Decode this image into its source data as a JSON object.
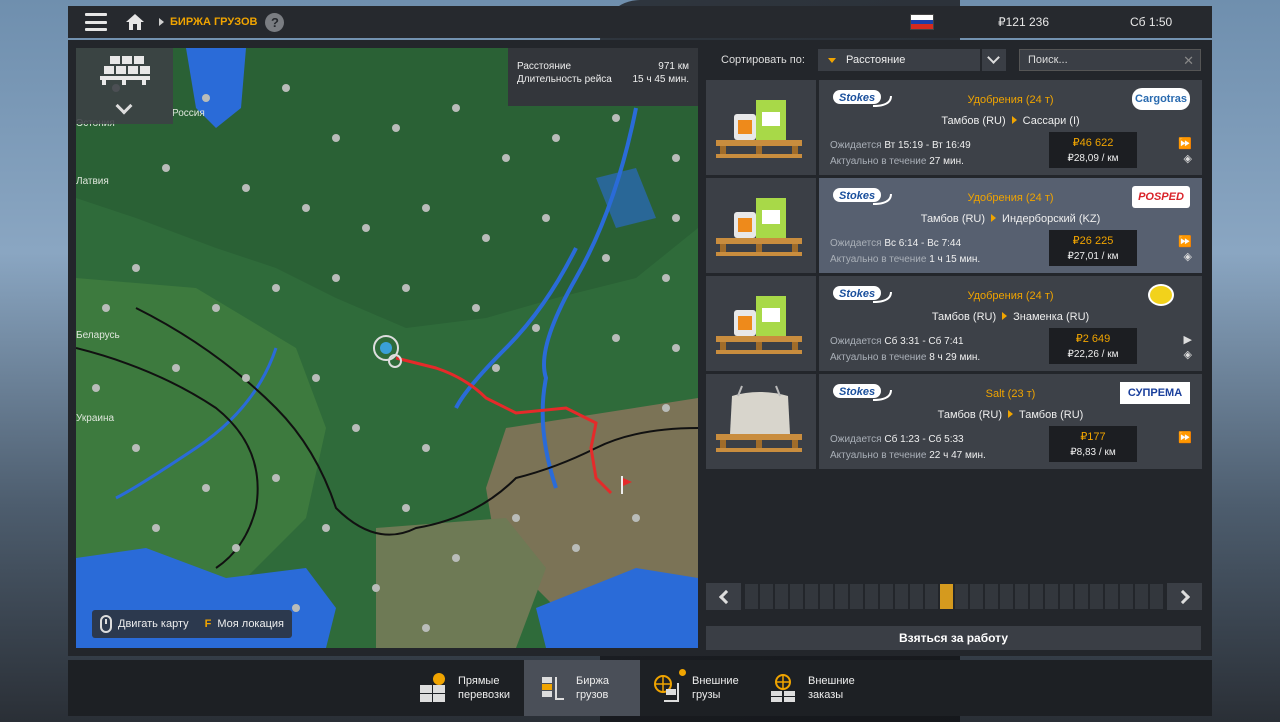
{
  "topbar": {
    "breadcrumb": "БИРЖА ГРУЗОВ",
    "help_label": "?",
    "money": "₽121 236",
    "time": "Сб 1:50"
  },
  "map": {
    "route_info": {
      "distance_label": "Расстояние",
      "distance_value": "971 км",
      "duration_label": "Длительность рейса",
      "duration_value": "15 ч 45 мин."
    },
    "labels": {
      "estonia": "Эстония",
      "russia": "Россия",
      "latvia": "Латвия",
      "belarus": "Беларусь",
      "ukraine": "Украина"
    },
    "controls": {
      "move_map": "Двигать карту",
      "key": "F",
      "my_location": "Моя локация"
    }
  },
  "sort": {
    "label": "Сортировать по:",
    "selected": "Расстояние",
    "search_placeholder": "Поиск..."
  },
  "jobs": [
    {
      "brand": "Stokes",
      "cargo": "Удобрения (24 т)",
      "from": "Тамбов (RU)",
      "to": "Сассари (I)",
      "expected_label": "Ожидается",
      "expected": "Вт 15:19 - Вт 16:49",
      "valid_label": "Актуально в течение",
      "valid": "27 мин.",
      "price": "₽46 622",
      "per_km": "₽28,09 / км",
      "company": "Cargotras",
      "company_color": "#2a6bb0"
    },
    {
      "brand": "Stokes",
      "cargo": "Удобрения (24 т)",
      "from": "Тамбов (RU)",
      "to": "Индерборский (KZ)",
      "expected_label": "Ожидается",
      "expected": "Вс 6:14 - Вс 7:44",
      "valid_label": "Актуально в течение",
      "valid": "1 ч 15 мин.",
      "price": "₽26 225",
      "per_km": "₽27,01 / км",
      "company": "POSPED",
      "company_color": "#d9232a"
    },
    {
      "brand": "Stokes",
      "cargo": "Удобрения (24 т)",
      "from": "Тамбов (RU)",
      "to": "Знаменка (RU)",
      "expected_label": "Ожидается",
      "expected": "Сб 3:31 - Сб 7:41",
      "valid_label": "Актуально в течение",
      "valid": "8 ч 29 мин.",
      "price": "₽2 649",
      "per_km": "₽22,26 / км",
      "company": "",
      "company_color": "#f2d21b"
    },
    {
      "brand": "Stokes",
      "cargo": "Salt (23 т)",
      "from": "Тамбов (RU)",
      "to": "Тамбов (RU)",
      "expected_label": "Ожидается",
      "expected": "Сб 1:23 - Сб 5:33",
      "valid_label": "Актуально в течение",
      "valid": "22 ч 47 мин.",
      "price": "₽177",
      "per_km": "₽8,83 / км",
      "company": "СУПРЕМА",
      "company_color": "#1a3f9c"
    }
  ],
  "pager": {
    "current_page": 14,
    "total_pages": 28
  },
  "take_job": "Взяться за работу",
  "tabs": [
    {
      "label": "Прямые\nперевозки",
      "icon": "direct-freight-icon"
    },
    {
      "label": "Биржа\nгрузов",
      "icon": "freight-market-icon"
    },
    {
      "label": "Внешние\nгрузы",
      "icon": "external-cargo-icon"
    },
    {
      "label": "Внешние\nзаказы",
      "icon": "external-contracts-icon"
    }
  ],
  "colors": {
    "accent": "#f0a400",
    "route": "#e52a2a",
    "forest": "#2f6b3a",
    "water": "#2a6bd8"
  }
}
